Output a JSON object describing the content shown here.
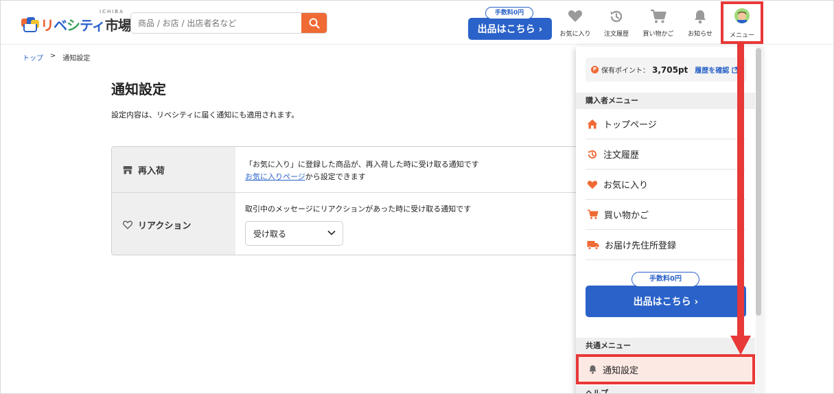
{
  "header": {
    "logo_text_1": "リ",
    "logo_text_2": "ベ",
    "logo_text_3": "シ",
    "logo_text_4": "ティ",
    "logo_text_5": "市場",
    "logo_sub": "ICHIBA",
    "search_placeholder": "商品 / お店 / 出店者名など",
    "fee_badge": "手数料0円",
    "sell_button": "出品はこちら ›",
    "nav": [
      {
        "label": "お気に入り",
        "icon": "heart-icon"
      },
      {
        "label": "注文履歴",
        "icon": "history-icon"
      },
      {
        "label": "買い物かご",
        "icon": "cart-icon"
      },
      {
        "label": "お知らせ",
        "icon": "bell-icon"
      },
      {
        "label": "メニュー",
        "icon": "avatar"
      }
    ]
  },
  "breadcrumb": {
    "home": "トップ",
    "sep": ">",
    "current": "通知設定"
  },
  "main": {
    "title": "通知設定",
    "description": "設定内容は、リベシティに届く通知にも適用されます。",
    "settings": [
      {
        "label": "再入荷",
        "text": "「お気に入り」に登録した商品が、再入荷した時に受け取る通知です",
        "link": "お気に入りページ",
        "link_suffix": "から設定できます"
      },
      {
        "label": "リアクション",
        "text": "取引中のメッセージにリアクションがあった時に受け取る通知です",
        "select_value": "受け取る"
      }
    ]
  },
  "menu_panel": {
    "points_label": "保有ポイント：",
    "points_value": "3,705pt",
    "points_link": "履歴を確認",
    "points_icon_letter": "P",
    "buyer_menu_title": "購入者メニュー",
    "buyer_items": [
      {
        "label": "トップページ",
        "icon": "home-icon"
      },
      {
        "label": "注文履歴",
        "icon": "history-icon"
      },
      {
        "label": "お気に入り",
        "icon": "heart-icon"
      },
      {
        "label": "買い物かご",
        "icon": "cart-icon"
      },
      {
        "label": "お届け先住所登録",
        "icon": "truck-icon"
      }
    ],
    "fee_badge": "手数料0円",
    "sell_button": "出品はこちら ›",
    "common_menu_title": "共通メニュー",
    "notification_settings": "通知設定",
    "help_title": "ヘルプ"
  },
  "colors": {
    "brand_blue": "#2a62c9",
    "brand_orange": "#f06a35",
    "highlight_red": "#e83838"
  }
}
